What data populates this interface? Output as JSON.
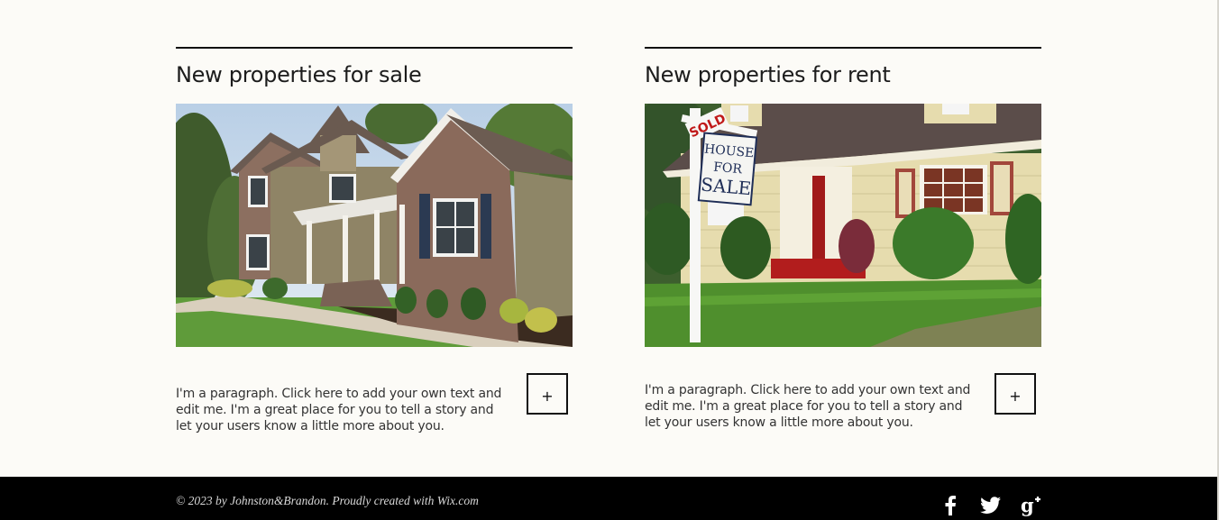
{
  "sections": {
    "sale": {
      "title": "New properties for sale",
      "paragraph": "I'm a paragraph. Click here to add your own text and edit me. I'm a great place for you to tell a story and let your users know a little more about you.",
      "button_label": "+"
    },
    "rent": {
      "title": "New properties for rent",
      "paragraph": "I'm a paragraph. Click here to add your own text and edit me. I'm a great place for you to tell a story and let your users know a little more about you.",
      "button_label": "+",
      "sign": {
        "rider": "SOLD",
        "line1": "HOUSE",
        "line2": "FOR",
        "line3": "SALE"
      }
    }
  },
  "footer": {
    "copyright": "© 2023 by Johnston&Brandon. Proudly created with Wix.com",
    "social": [
      "facebook-icon",
      "twitter-icon",
      "google-plus-icon"
    ]
  },
  "colors": {
    "background": "#fcfbf7",
    "footer": "#000000",
    "text": "#333333",
    "rule": "#111111"
  }
}
